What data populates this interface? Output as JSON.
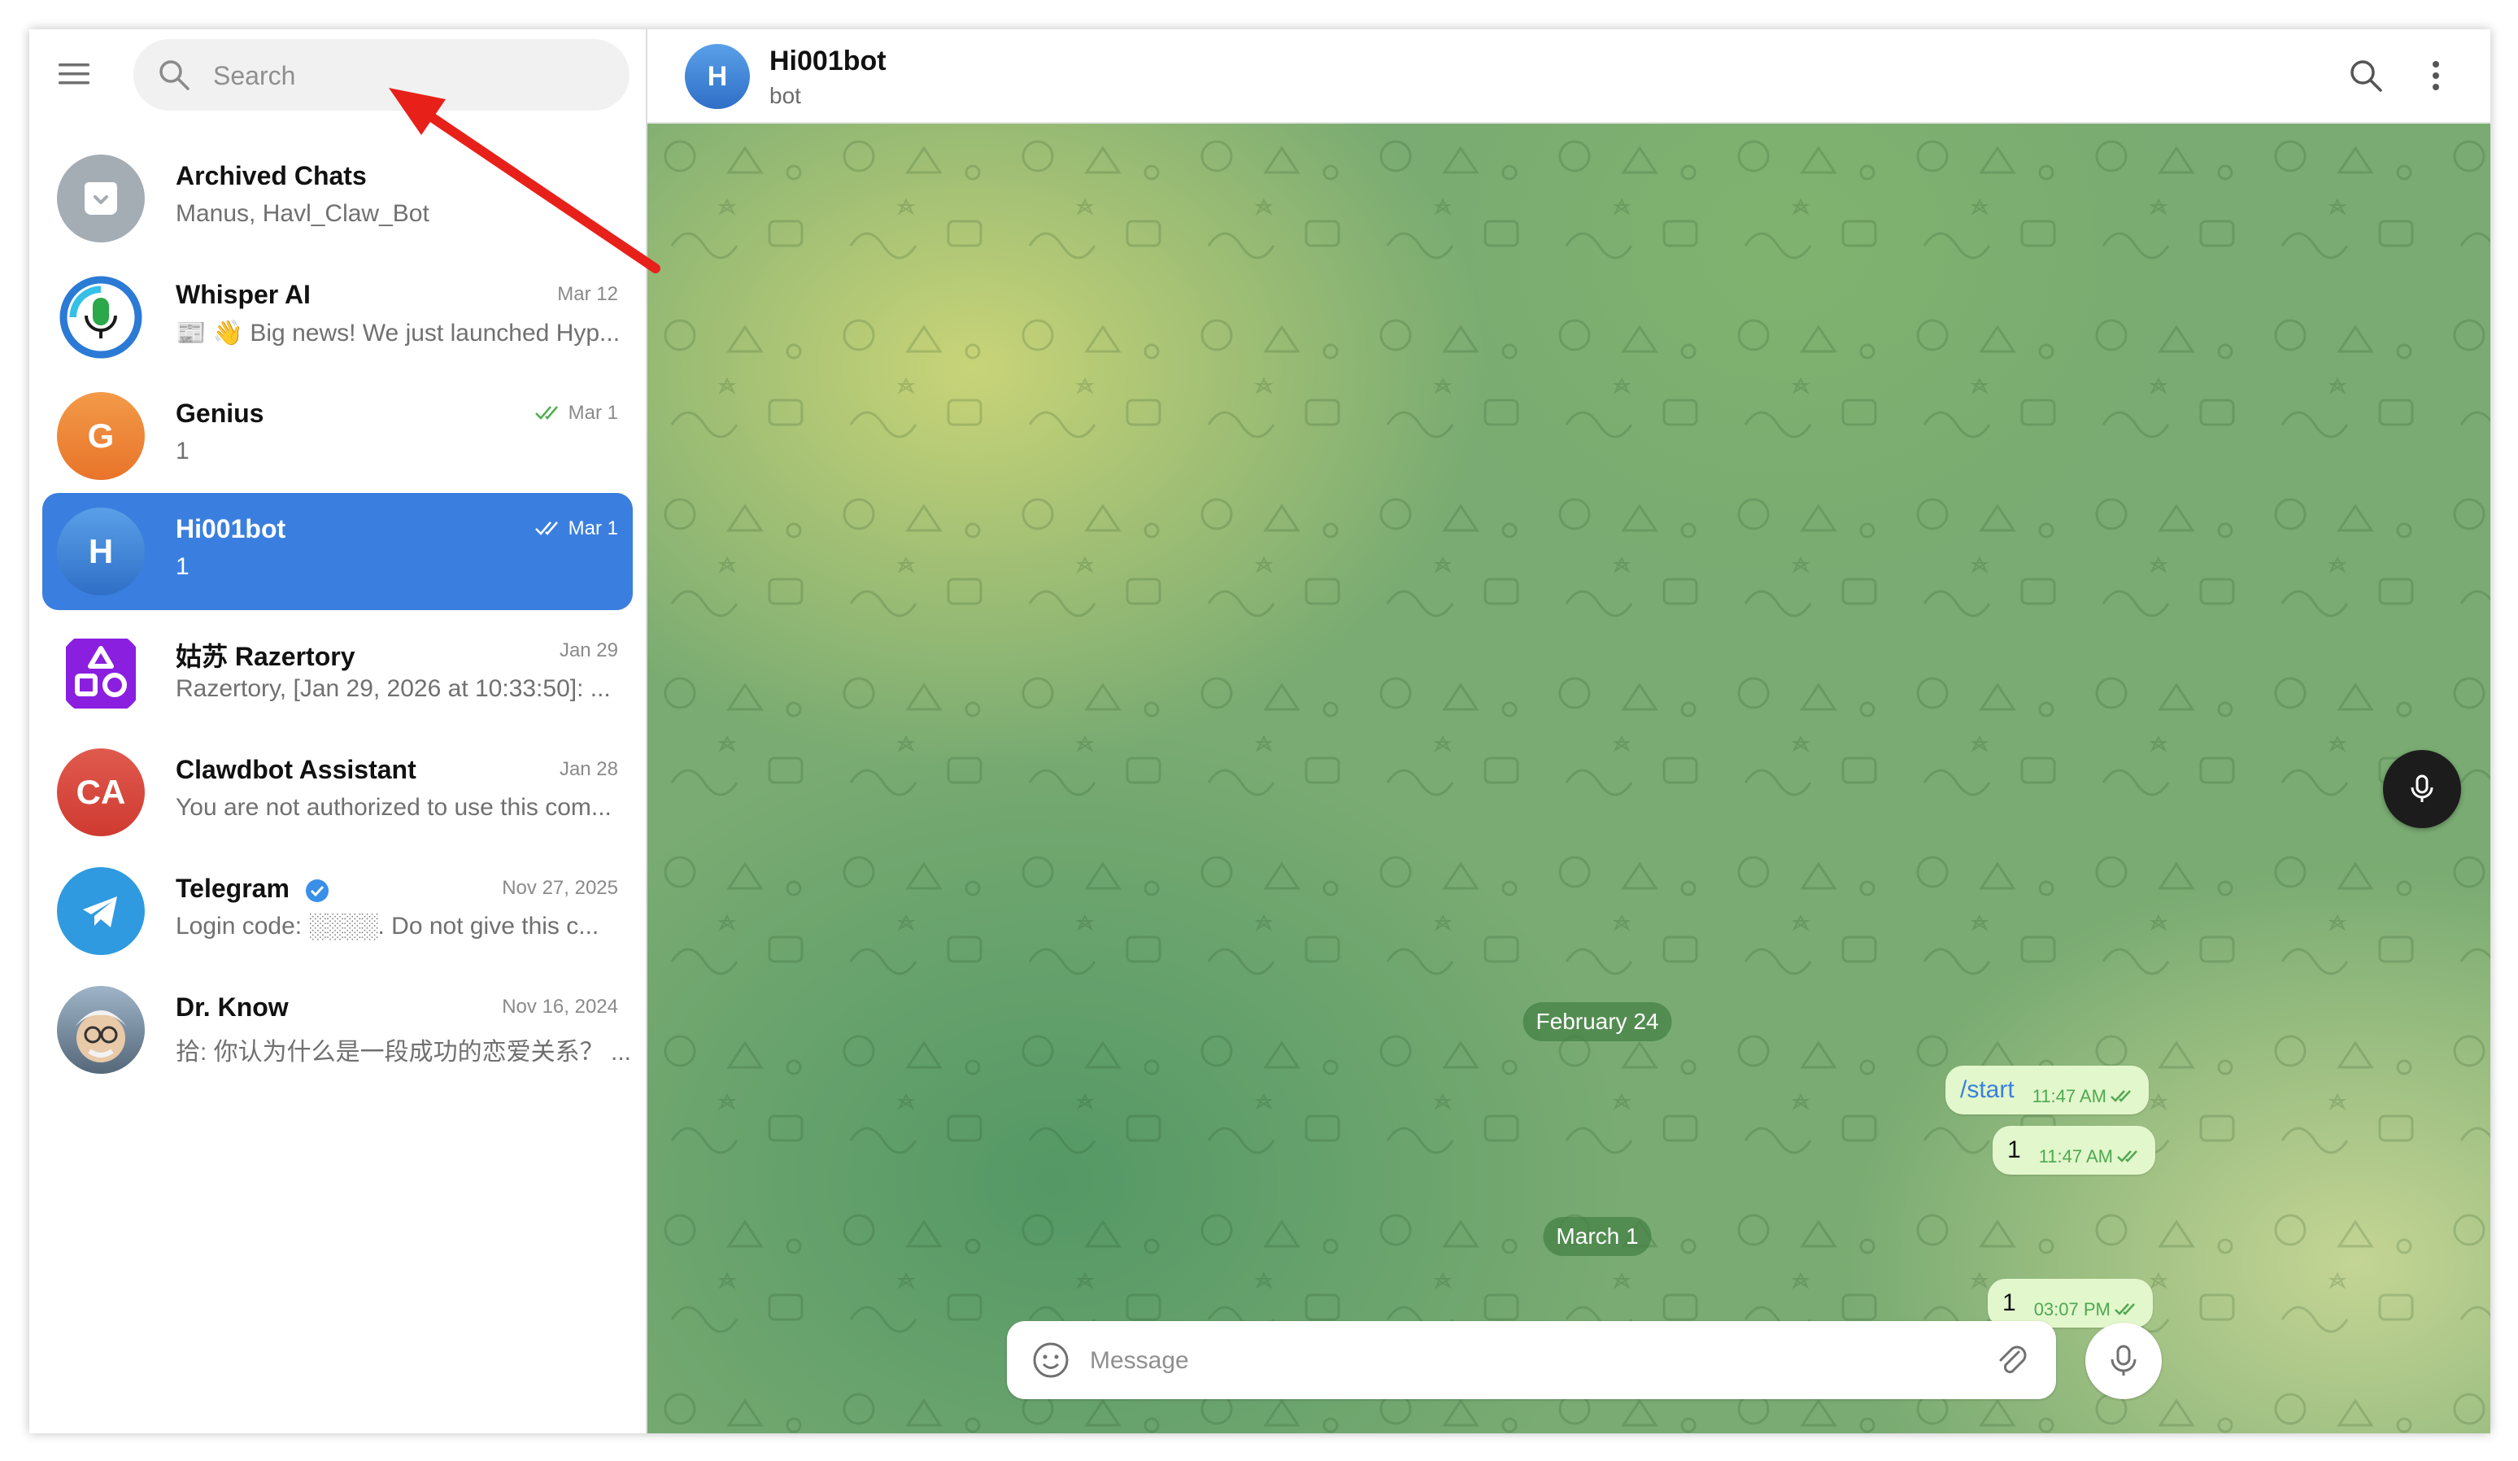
{
  "sidebar": {
    "search_placeholder": "Search",
    "chats": [
      {
        "name": "Archived Chats",
        "preview": "Manus, Havl_Claw_Bot",
        "date": "",
        "avatar_text": "",
        "avatar_color": "#a4acb4"
      },
      {
        "name": "Whisper AI",
        "preview": "📰 👋 Big news! We just launched Hyp...",
        "date": "Mar 12",
        "avatar_text": "",
        "avatar_color": "#ffffff"
      },
      {
        "name": "Genius",
        "preview": "1",
        "date": "Mar 1",
        "avatar_text": "G",
        "avatar_color": "#ef8a3a"
      },
      {
        "name": "Hi001bot",
        "preview": "1",
        "date": "Mar 1",
        "avatar_text": "H",
        "avatar_color": "#3f82d6"
      },
      {
        "name": "姑苏 Razertory",
        "preview": "Razertory, [Jan 29, 2026 at 10:33:50]: ...",
        "date": "Jan 29",
        "avatar_text": "",
        "avatar_color": "#8a1fe0"
      },
      {
        "name": "Clawdbot Assistant",
        "preview": "You are not authorized to use this com...",
        "date": "Jan 28",
        "avatar_text": "CA",
        "avatar_color": "#d9453b"
      },
      {
        "name": "Telegram",
        "preview": "Login code: ░░░░. Do not give this c...",
        "date": "Nov 27, 2025",
        "avatar_text": "",
        "avatar_color": "#2f9ae0"
      },
      {
        "name": "Dr. Know",
        "preview": "拾: 你认为什么是一段成功的恋爱关系？ ...",
        "date": "Nov 16, 2024",
        "avatar_text": "",
        "avatar_color": "#7a8ea0"
      }
    ]
  },
  "header": {
    "avatar_text": "H",
    "title": "Hi001bot",
    "subtitle": "bot"
  },
  "messages": {
    "date1": "February 24",
    "msg1_text": "/start",
    "msg1_time": "11:47 AM",
    "msg2_text": "1",
    "msg2_time": "11:47 AM",
    "date2": "March 1",
    "msg3_text": "1",
    "msg3_time": "03:07 PM"
  },
  "composer": {
    "placeholder": "Message"
  },
  "colors": {
    "accent": "#3a7fdf",
    "annotation_arrow": "#e8201a",
    "bubble": "#e2f7cb"
  }
}
